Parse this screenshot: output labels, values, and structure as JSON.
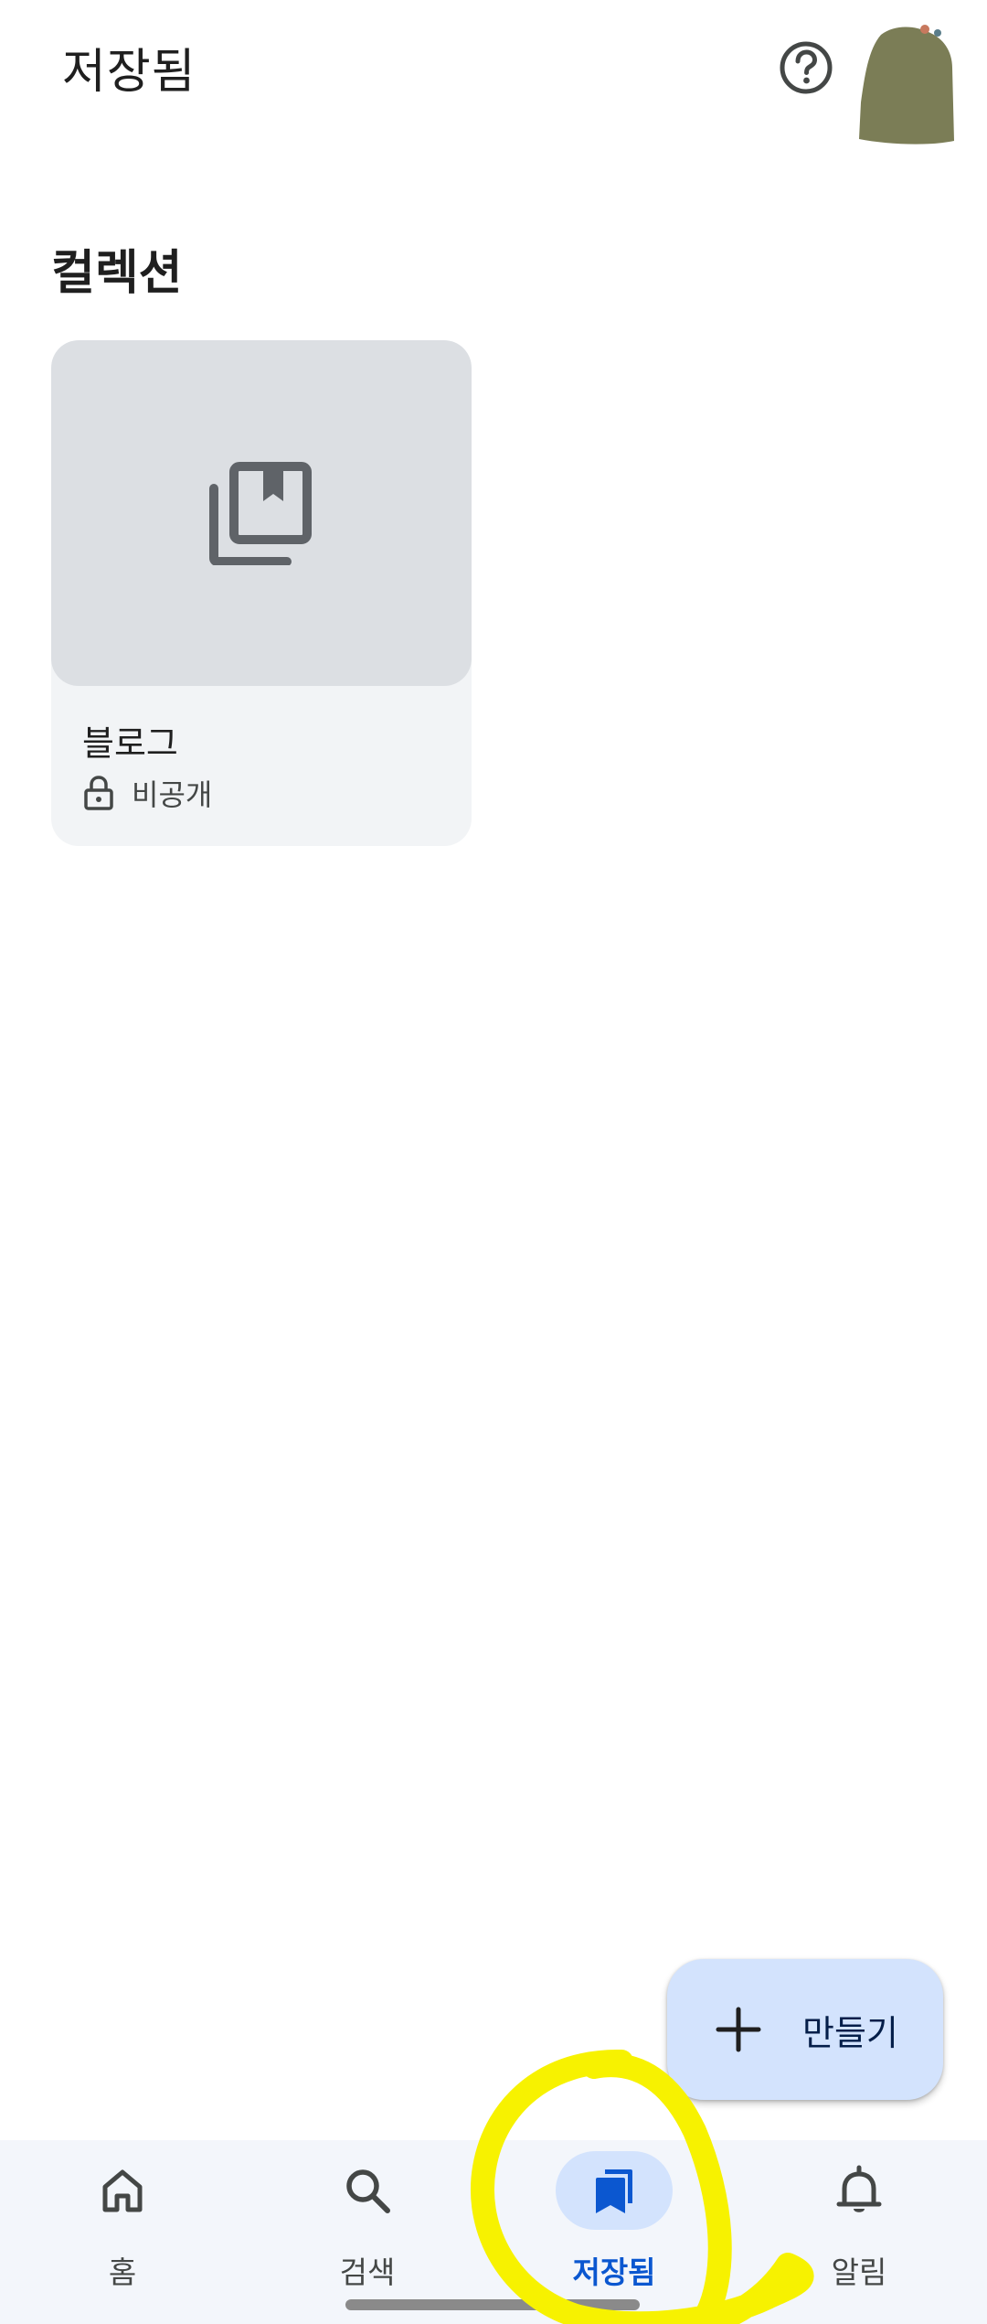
{
  "header": {
    "title": "저장됨",
    "help_icon": "help-circle-icon"
  },
  "collections": {
    "section_title": "컬렉션",
    "items": [
      {
        "name": "블로그",
        "privacy": "비공개",
        "thumb_icon": "bookmark-library-icon",
        "privacy_icon": "lock-icon"
      }
    ]
  },
  "fab": {
    "label": "만들기",
    "icon": "plus-icon"
  },
  "bottom_nav": {
    "items": [
      {
        "label": "홈",
        "icon": "home-icon",
        "active": false
      },
      {
        "label": "검색",
        "icon": "search-icon",
        "active": false
      },
      {
        "label": "저장됨",
        "icon": "bookmarks-icon",
        "active": true
      },
      {
        "label": "알림",
        "icon": "bell-icon",
        "active": false
      }
    ]
  },
  "colors": {
    "accent": "#0b57d0",
    "fab_background": "#d3e3fd",
    "annotation": "#f7f200"
  }
}
